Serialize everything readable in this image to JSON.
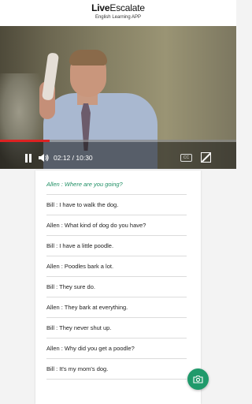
{
  "header": {
    "logo_part1": "Live",
    "logo_part2": "Escalate",
    "subtitle": "English Learning APP"
  },
  "player": {
    "current_time": "02:12",
    "separator": " / ",
    "duration": "10:30",
    "progress_fraction": 0.21,
    "cc_label": "CC"
  },
  "transcript": [
    {
      "text": "Allen : Where are you going?",
      "active": true
    },
    {
      "text": "Bill : I have to walk the dog.",
      "active": false
    },
    {
      "text": "Allen : What kind of dog do you have?",
      "active": false
    },
    {
      "text": "Bill : I have a little poodle.",
      "active": false
    },
    {
      "text": "Allen : Poodles bark a lot.",
      "active": false
    },
    {
      "text": "Bill : They sure do.",
      "active": false
    },
    {
      "text": "Allen : They bark at everything.",
      "active": false
    },
    {
      "text": "Bill : They never shut up.",
      "active": false
    },
    {
      "text": "Allen : Why did you get a poodle?",
      "active": false
    },
    {
      "text": "Bill : It's my mom's dog.",
      "active": false
    }
  ],
  "colors": {
    "accent": "#1f9a6b",
    "active_line": "#1f8f64",
    "progress": "#dd2222"
  },
  "icons": {
    "pause": "pause-icon",
    "volume": "volume-icon",
    "captions": "cc-icon",
    "fullscreen": "fullscreen-icon",
    "fab": "camera-icon"
  }
}
